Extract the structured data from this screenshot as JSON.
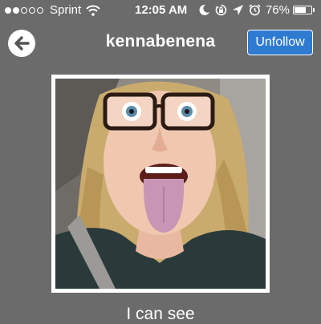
{
  "status_bar": {
    "carrier": "Sprint",
    "time": "12:05 AM",
    "battery_percent": "76%",
    "battery_level": 0.76,
    "signal_bars_filled": 2,
    "signal_bars_total": 5,
    "icons": [
      "wifi-icon",
      "moon-icon",
      "rotation-lock-icon",
      "location-icon",
      "alarm-icon"
    ]
  },
  "header": {
    "username": "kennabenena",
    "follow_button_label": "Unfollow",
    "back_icon": "back-arrow-icon"
  },
  "photo": {
    "description_icon": "selfie-photo"
  },
  "caption": {
    "text": "I can see"
  },
  "colors": {
    "background": "#6b6b6b",
    "accent": "#2e7bd1",
    "text": "#ffffff"
  }
}
